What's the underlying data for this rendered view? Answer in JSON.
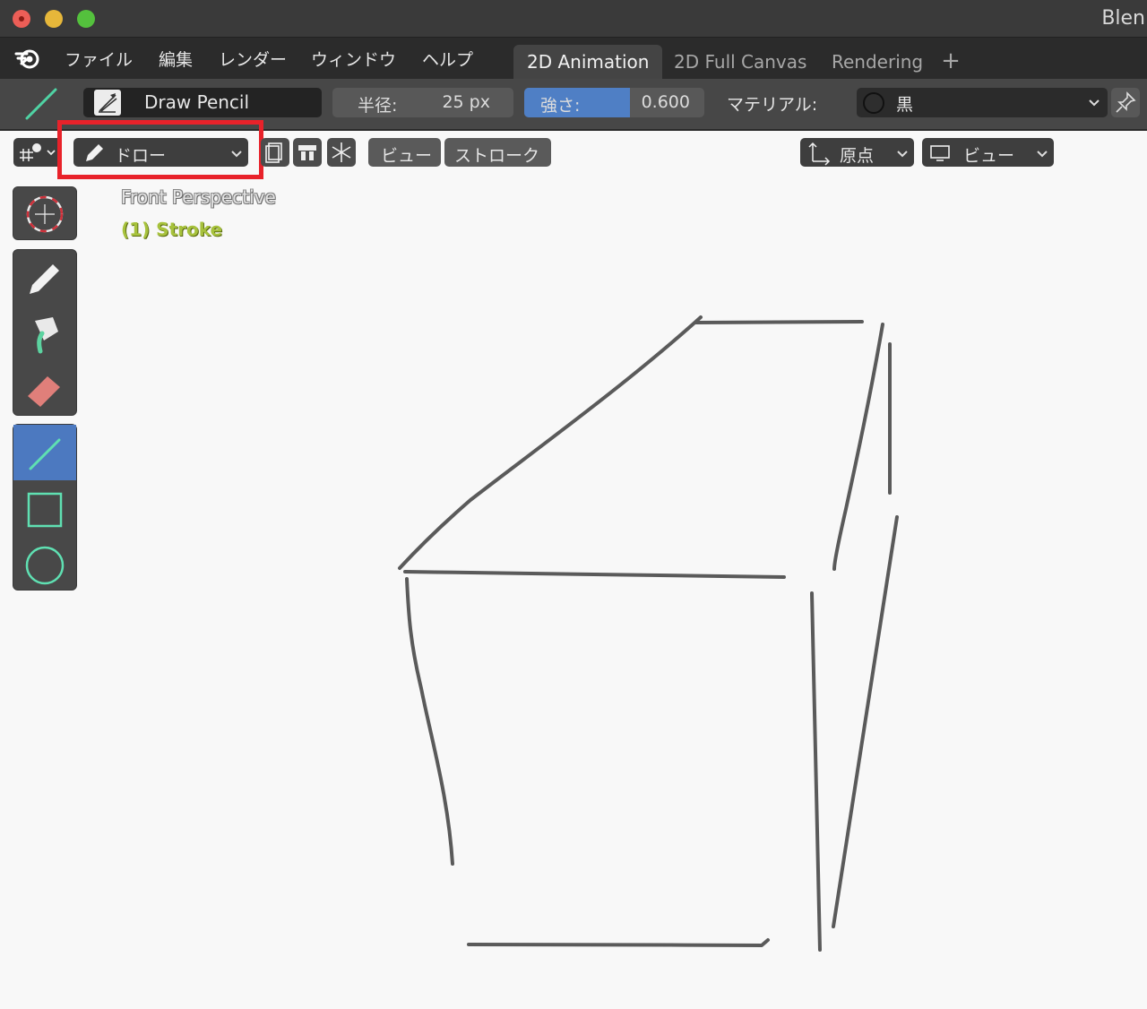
{
  "window": {
    "title": "Blen"
  },
  "menu": {
    "items": [
      "ファイル",
      "編集",
      "レンダー",
      "ウィンドウ",
      "ヘルプ"
    ],
    "workspace_tabs": [
      "2D Animation",
      "2D Full Canvas",
      "Rendering"
    ],
    "active_tab": "2D Animation",
    "add_tab_symbol": "+"
  },
  "tool_header": {
    "brush_name": "Draw Pencil",
    "radius_label": "半径:",
    "radius_value": "25 px",
    "strength_label": "強さ:",
    "strength_value": "0.600",
    "strength_fraction": 0.6,
    "material_label": "マテリアル:",
    "material_name": "黒"
  },
  "viewport_header": {
    "mode_label": "ドロー",
    "view_menu": "ビュー",
    "stroke_menu": "ストローク",
    "origin_label": "原点",
    "view_label": "ビュー"
  },
  "viewport_overlay": {
    "view_name": "Front Perspective",
    "object_info": "(1) Stroke"
  },
  "toolbar": {
    "tools": [
      "cursor",
      "draw",
      "fill",
      "erase",
      "line",
      "box",
      "circle"
    ],
    "active_tool": "line"
  },
  "colors": {
    "accent": "#4c79c0",
    "highlight_box": "#e8222a",
    "stroke": "#5a5a5a",
    "object_info": "#a7c23c",
    "line_tool": "#4fd3a4"
  }
}
